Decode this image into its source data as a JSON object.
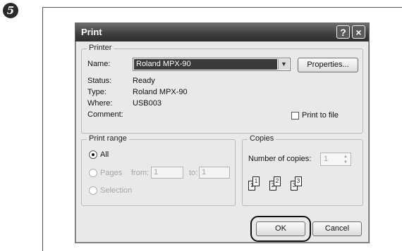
{
  "step": "5",
  "dialog": {
    "title": "Print",
    "help_button": "?",
    "close_button": "×"
  },
  "printer": {
    "group_label": "Printer",
    "name_label": "Name:",
    "name_value": "Roland MPX-90",
    "properties_button": "Properties...",
    "status_label": "Status:",
    "status_value": "Ready",
    "type_label": "Type:",
    "type_value": "Roland MPX-90",
    "where_label": "Where:",
    "where_value": "USB003",
    "comment_label": "Comment:",
    "print_to_file_label": "Print to file"
  },
  "print_range": {
    "group_label": "Print range",
    "all_label": "All",
    "pages_label": "Pages",
    "from_label": "from:",
    "from_value": "1",
    "to_label": "to:",
    "to_value": "1",
    "selection_label": "Selection"
  },
  "copies": {
    "group_label": "Copies",
    "number_label": "Number of copies:",
    "number_value": "1",
    "collate_pages": [
      "1",
      "1",
      "2",
      "2",
      "3",
      "3"
    ]
  },
  "buttons": {
    "ok": "OK",
    "cancel": "Cancel"
  }
}
